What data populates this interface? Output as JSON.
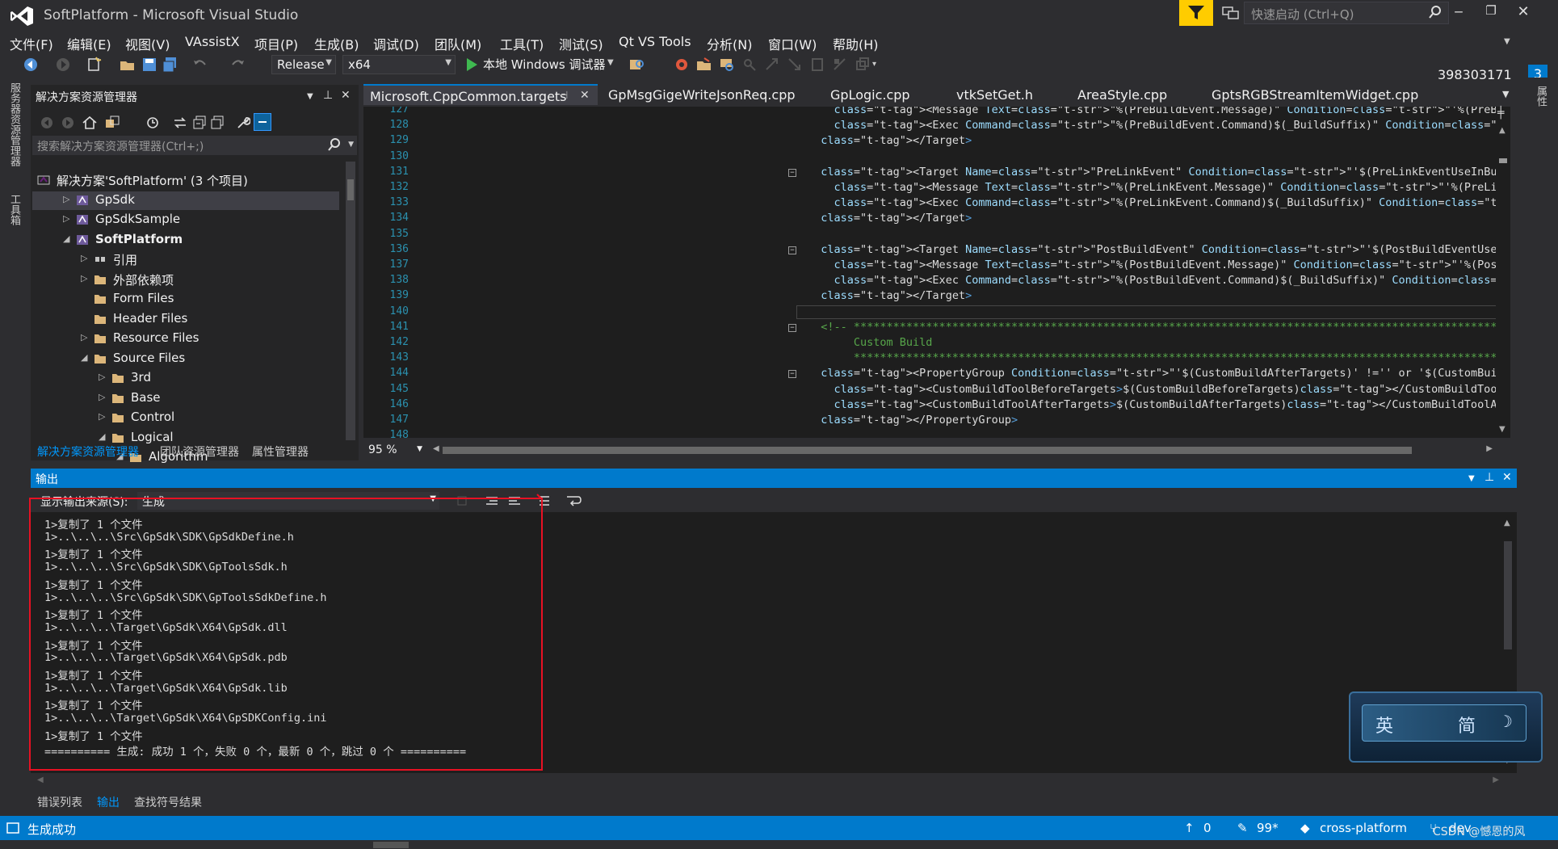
{
  "window": {
    "title": "SoftPlatform - Microsoft Visual Studio",
    "quick_launch_placeholder": "快速启动 (Ctrl+Q)",
    "user": "398303171",
    "notification_count": "3"
  },
  "menu": [
    "文件(F)",
    "编辑(E)",
    "视图(V)",
    "VAssistX",
    "项目(P)",
    "生成(B)",
    "调试(D)",
    "团队(M)",
    "工具(T)",
    "测试(S)",
    "Qt VS Tools",
    "分析(N)",
    "窗口(W)",
    "帮助(H)"
  ],
  "toolbar": {
    "configuration": "Release",
    "platform": "x64",
    "debugger": "本地 Windows 调试器"
  },
  "side_rails": {
    "left": [
      "服务器资源管理器",
      "工具箱"
    ],
    "right": [
      "属性"
    ]
  },
  "solution_explorer": {
    "title": "解决方案资源管理器",
    "search_placeholder": "搜索解决方案资源管理器(Ctrl+;)",
    "tree": [
      {
        "label": "解决方案'SoftPlatform' (3 个项目)",
        "indent": 0,
        "arrow": "",
        "icon": "solution"
      },
      {
        "label": "GpSdk",
        "indent": 1,
        "arrow": "▷",
        "icon": "project",
        "selected": true
      },
      {
        "label": "GpSdkSample",
        "indent": 1,
        "arrow": "▷",
        "icon": "project"
      },
      {
        "label": "SoftPlatform",
        "indent": 1,
        "arrow": "◢",
        "icon": "project",
        "bold": true
      },
      {
        "label": "引用",
        "indent": 2,
        "arrow": "▷",
        "icon": "references"
      },
      {
        "label": "外部依赖项",
        "indent": 2,
        "arrow": "▷",
        "icon": "folder"
      },
      {
        "label": "Form Files",
        "indent": 2,
        "arrow": "",
        "icon": "folder"
      },
      {
        "label": "Header Files",
        "indent": 2,
        "arrow": "",
        "icon": "folder"
      },
      {
        "label": "Resource Files",
        "indent": 2,
        "arrow": "▷",
        "icon": "folder"
      },
      {
        "label": "Source Files",
        "indent": 2,
        "arrow": "◢",
        "icon": "folder"
      },
      {
        "label": "3rd",
        "indent": 3,
        "arrow": "▷",
        "icon": "folder"
      },
      {
        "label": "Base",
        "indent": 3,
        "arrow": "▷",
        "icon": "folder"
      },
      {
        "label": "Control",
        "indent": 3,
        "arrow": "▷",
        "icon": "folder"
      },
      {
        "label": "Logical",
        "indent": 3,
        "arrow": "◢",
        "icon": "folder"
      },
      {
        "label": "Algorithm",
        "indent": 4,
        "arrow": "◢",
        "icon": "folder"
      }
    ],
    "tabs": [
      "解决方案资源管理器",
      "团队资源管理器",
      "属性管理器"
    ]
  },
  "editor": {
    "tabs": [
      "Microsoft.CppCommon.targets",
      "GpMsgGigeWriteJsonReq.cpp",
      "GpLogic.cpp",
      "vtkSetGet.h",
      "AreaStyle.cpp",
      "GptsRGBStreamItemWidget.cpp"
    ],
    "active_tab": 0,
    "zoom": "95 %",
    "lines": [
      {
        "n": "127",
        "text": "    <Message Text=\"%(PreBuildEvent.Message)\" Condition=\"'%(PreBuildEvent.Message)' != '' and '%(PreBuildEvent.Command)' != ''\" Importance=\"High\" />",
        "kind": "tag"
      },
      {
        "n": "128",
        "text": "    <Exec Command=\"%(PreBuildEvent.Command)$(_BuildSuffix)\" Condition=\"'%(PreBuildEvent.Command)' != ''\"/>",
        "kind": "tag"
      },
      {
        "n": "129",
        "text": "  </Target>",
        "kind": "tag"
      },
      {
        "n": "130",
        "text": "",
        "kind": "txt"
      },
      {
        "n": "131",
        "text": "  <Target Name=\"PreLinkEvent\" Condition=\"'$(PreLinkEventUseInBuild)'!='false'\">",
        "kind": "tag",
        "fold": "⊟"
      },
      {
        "n": "132",
        "text": "    <Message Text=\"%(PreLinkEvent.Message)\" Condition=\"'%(PreLinkEvent.Message)' != '' and '%(PreLinkEvent.Command)' != ''\" Importance=\"High\" />",
        "kind": "tag"
      },
      {
        "n": "133",
        "text": "    <Exec Command=\"%(PreLinkEvent.Command)$(_BuildSuffix)\" Condition=\"'%(PreLinkEvent.Command)' != ''\"/>",
        "kind": "tag"
      },
      {
        "n": "134",
        "text": "  </Target>",
        "kind": "tag"
      },
      {
        "n": "135",
        "text": "",
        "kind": "txt"
      },
      {
        "n": "136",
        "text": "  <Target Name=\"PostBuildEvent\" Condition=\"'$(PostBuildEventUseInBuild)'!='false'\">",
        "kind": "tag",
        "fold": "⊟"
      },
      {
        "n": "137",
        "text": "    <Message Text=\"%(PostBuildEvent.Message)\" Condition=\"'%(PostBuildEvent.Message)' != '' and '%(PostBuildEvent.Command)' != ''\" Importance=\"High\" />",
        "kind": "tag"
      },
      {
        "n": "138",
        "text": "    <Exec Command=\"%(PostBuildEvent.Command)$(_BuildSuffix)\" Condition=\"'%(PostBuildEvent.Command)' != ''\"/>",
        "kind": "tag"
      },
      {
        "n": "139",
        "text": "  </Target>",
        "kind": "tag"
      },
      {
        "n": "140",
        "text": "",
        "kind": "txt"
      },
      {
        "n": "141",
        "text": "  <!-- ******************************************************************************************************",
        "kind": "com",
        "fold": "⊟"
      },
      {
        "n": "142",
        "text": "       Custom Build",
        "kind": "com"
      },
      {
        "n": "143",
        "text": "       ****************************************************************************************************** -->",
        "kind": "com"
      },
      {
        "n": "144",
        "text": "  <PropertyGroup Condition=\"'$(CustomBuildAfterTargets)' !='' or '$(CustomBuildBeforeTargets)'!=''\">",
        "kind": "tag",
        "fold": "⊟"
      },
      {
        "n": "145",
        "text": "    <CustomBuildToolBeforeTargets>$(CustomBuildBeforeTargets)</CustomBuildToolBeforeTargets>",
        "kind": "tag"
      },
      {
        "n": "146",
        "text": "    <CustomBuildToolAfterTargets>$(CustomBuildAfterTargets)</CustomBuildToolAfterTargets>",
        "kind": "tag"
      },
      {
        "n": "147",
        "text": "  </PropertyGroup>",
        "kind": "tag"
      },
      {
        "n": "148",
        "text": "",
        "kind": "txt"
      }
    ]
  },
  "output": {
    "title": "输出",
    "source_label": "显示输出来源(S):",
    "source_value": "生成",
    "lines": [
      "1>复制了 1 个文件",
      "1>..\\..\\..\\Src\\GpSdk\\SDK\\GpSdkDefine.h",
      "1>复制了 1 个文件",
      "1>..\\..\\..\\Src\\GpSdk\\SDK\\GpToolsSdk.h",
      "1>复制了 1 个文件",
      "1>..\\..\\..\\Src\\GpSdk\\SDK\\GpToolsSdkDefine.h",
      "1>复制了 1 个文件",
      "1>..\\..\\..\\Target\\GpSdk\\X64\\GpSdk.dll",
      "1>复制了 1 个文件",
      "1>..\\..\\..\\Target\\GpSdk\\X64\\GpSdk.pdb",
      "1>复制了 1 个文件",
      "1>..\\..\\..\\Target\\GpSdk\\X64\\GpSdk.lib",
      "1>复制了 1 个文件",
      "1>..\\..\\..\\Target\\GpSdk\\X64\\GpSDKConfig.ini",
      "1>复制了 1 个文件",
      "========== 生成: 成功 1 个，失败 0 个，最新 0 个，跳过 0 个 =========="
    ]
  },
  "bottom_tabs": [
    "错误列表",
    "输出",
    "查找符号结果"
  ],
  "bottom_active": 1,
  "ime": {
    "lang": "英",
    "mode": "简"
  },
  "status": {
    "message": "生成成功",
    "up_count": "0",
    "edits": "99*",
    "branch": "cross-platform",
    "repo": "dev",
    "watermark": "CSDN @憾恩的风"
  },
  "colors": {
    "accent": "#007acc",
    "status_bar": "#007acc",
    "highlight_box": "#e81123",
    "notify": "#ffcc00"
  }
}
